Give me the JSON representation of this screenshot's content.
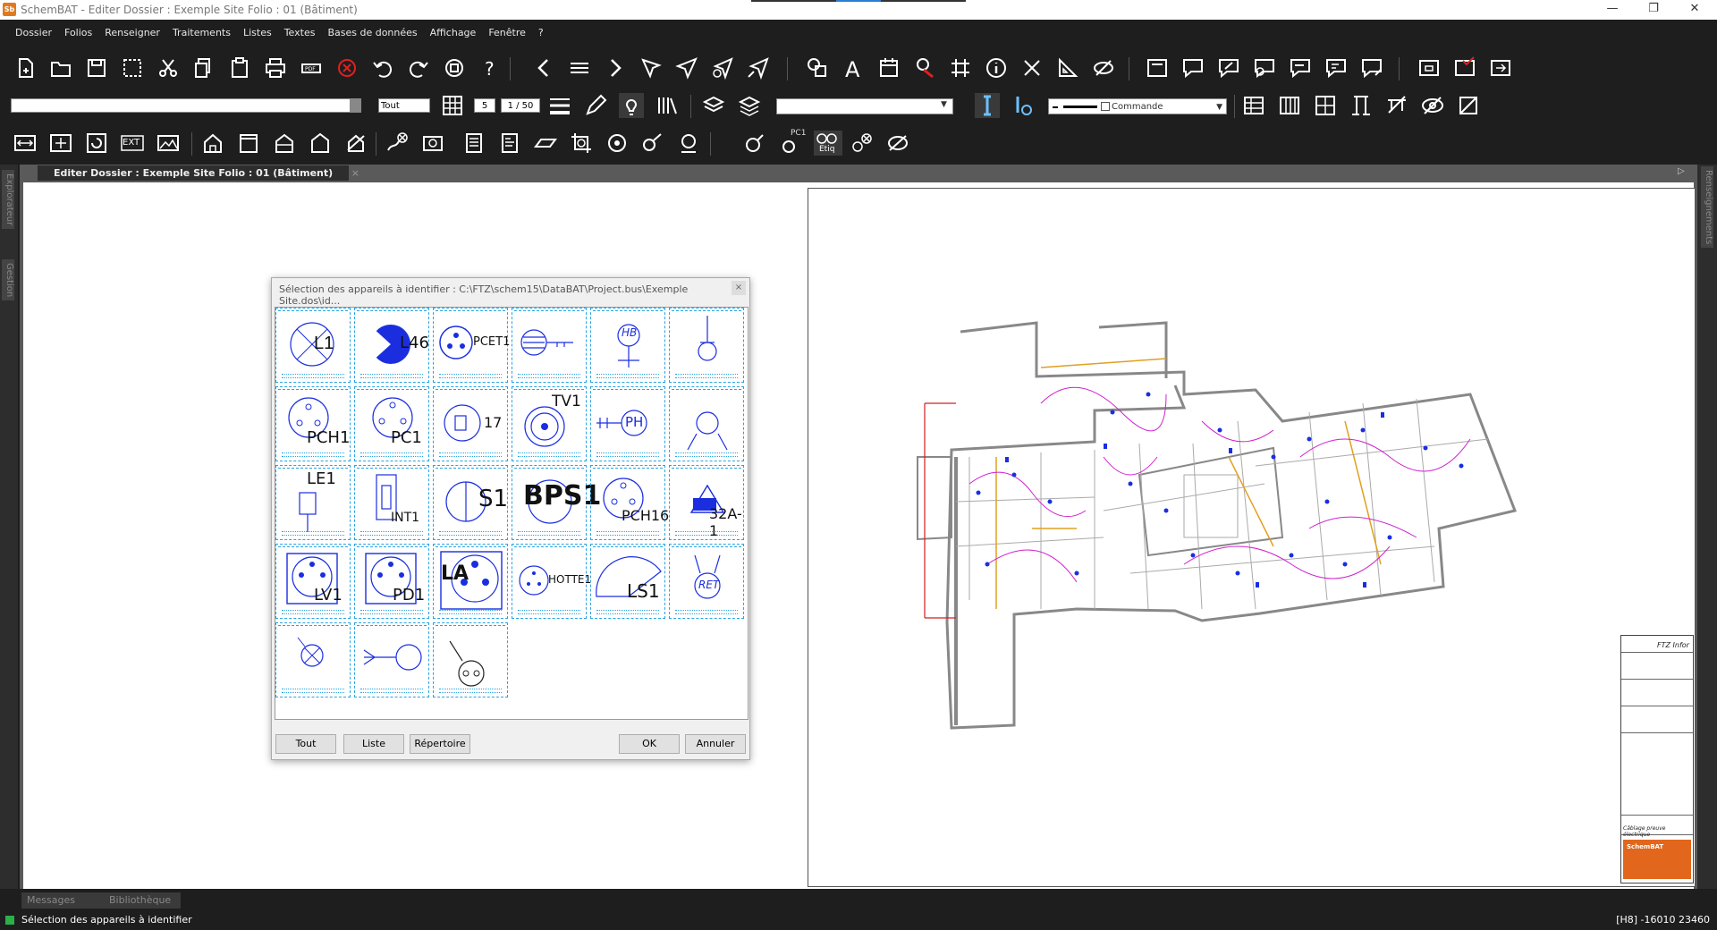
{
  "app": {
    "logo": "Sb",
    "title": "SchemBAT - Editer  Dossier : Exemple Site  Folio : 01  (Bâtiment)"
  },
  "menu": [
    "Dossier",
    "Folios",
    "Renseigner",
    "Traitements",
    "Listes",
    "Textes",
    "Bases de données",
    "Affichage",
    "Fenêtre",
    "?"
  ],
  "toolbar2": {
    "filter_value": "Tout",
    "number_value": "5",
    "page_value": "1 / 50",
    "layer_value": "",
    "command_value": "Commande"
  },
  "toolbar3": {
    "ext_label": "EXT",
    "pc1_label": "PC1",
    "etiq_label": "Etiq"
  },
  "document": {
    "tab_label": "Editer  Dossier : Exemple Site  Folio : 01  (Bâtiment)",
    "tab_close": "×"
  },
  "side": {
    "left_tabs": [
      "Explorateur",
      "Gestion"
    ],
    "right_tab": "Renseignements"
  },
  "dialog": {
    "title": "Sélection des appareils à identifier : C:\\FTZ\\schem15\\DataBAT\\Project.bus\\Exemple Site.dos\\id...",
    "close_label": "×",
    "symbols": [
      "L1",
      "L46",
      "PCET1",
      "",
      "HB",
      "",
      "PCH1",
      "PC1",
      "17",
      "TV1",
      "PH",
      "",
      "LE1",
      "INT1",
      "S1",
      "BPS1",
      "PCH16",
      "32A-1",
      "LV1",
      "PD1",
      "LA",
      "HOTTE1",
      "LS1",
      "RET",
      "",
      "",
      ""
    ],
    "buttons": {
      "all": "Tout",
      "list": "Liste",
      "directory": "Répertoire",
      "ok": "OK",
      "cancel": "Annuler"
    }
  },
  "title_block": {
    "company": "FTZ Infor",
    "brand": "SchemBAT",
    "subtitle": "Câblage preuve électrique"
  },
  "bottom_tabs": [
    "Messages",
    "Bibliothèque"
  ],
  "status": {
    "message": "Sélection des appareils à identifier",
    "coords": "[H8]  -16010  23460"
  }
}
